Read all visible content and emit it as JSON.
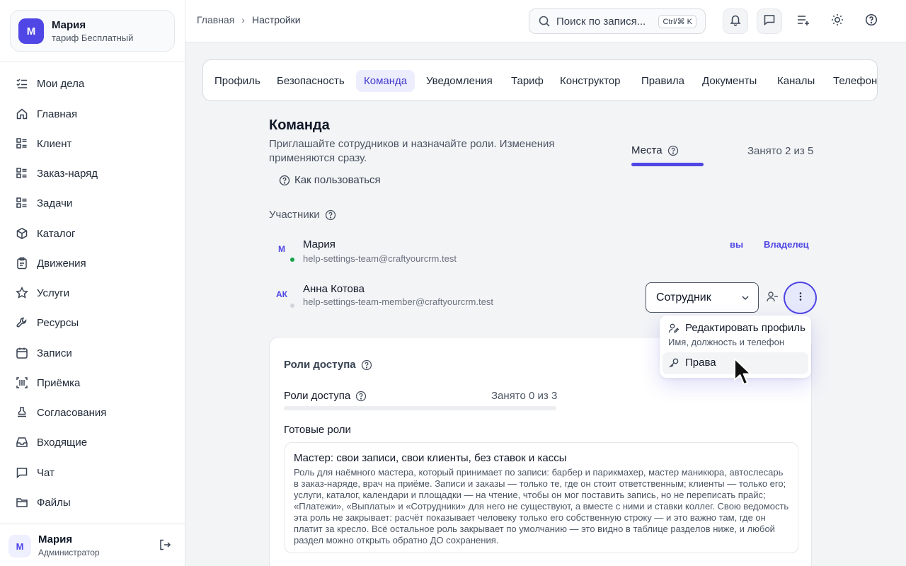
{
  "account": {
    "initial": "М",
    "name": "Мария",
    "plan": "тариф Бесплатный"
  },
  "sidebar": {
    "items": [
      {
        "label": "Мои дела",
        "icon": "task-list-icon"
      },
      {
        "label": "Главная",
        "icon": "home-icon"
      },
      {
        "label": "Клиент",
        "icon": "list-icon"
      },
      {
        "label": "Заказ-наряд",
        "icon": "list-icon"
      },
      {
        "label": "Задачи",
        "icon": "list-icon"
      },
      {
        "label": "Каталог",
        "icon": "box-icon"
      },
      {
        "label": "Движения",
        "icon": "clipboard-icon"
      },
      {
        "label": "Услуги",
        "icon": "star-icon"
      },
      {
        "label": "Ресурсы",
        "icon": "wrench-icon"
      },
      {
        "label": "Записи",
        "icon": "calendar-icon"
      },
      {
        "label": "Приёмка",
        "icon": "scan-icon"
      },
      {
        "label": "Согласования",
        "icon": "stamp-icon"
      },
      {
        "label": "Входящие",
        "icon": "inbox-icon"
      },
      {
        "label": "Чат",
        "icon": "chat-icon"
      },
      {
        "label": "Файлы",
        "icon": "folder-icon"
      }
    ]
  },
  "user": {
    "initial": "М",
    "name": "Мария",
    "role": "Администратор"
  },
  "breadcrumb": {
    "home": "Главная",
    "sep": "›",
    "current": "Настройки"
  },
  "search": {
    "placeholder": "Поиск по запися...",
    "shortcut": "Ctrl/⌘ K"
  },
  "tabs": [
    "Профиль",
    "Безопасность",
    "Команда",
    "Уведомления",
    "Тариф",
    "Конструктор",
    "Правила",
    "Документы",
    "Каналы",
    "Телефони"
  ],
  "team": {
    "title": "Команда",
    "description": "Приглашайте сотрудников и назначайте роли. Изменения применяются сразу.",
    "howto": "Как пользоваться",
    "seats_label": "Места",
    "seats_value": "Занято 2 из 5",
    "seats_fraction": 0.4,
    "members_label": "Участники",
    "members": [
      {
        "initials": "М",
        "name": "Мария",
        "email": "help-settings-team@craftyourcrm.test",
        "you": "вы",
        "role": "Владелец",
        "status_color": "#16a34a"
      },
      {
        "initials": "АК",
        "name": "Анна Котова",
        "email": "help-settings-team-member@craftyourcrm.test",
        "role": "Сотрудник",
        "status_color": "#d1d5db"
      }
    ]
  },
  "menu": {
    "edit_label": "Редактировать профиль",
    "edit_sub": "Имя, должность и телефон",
    "rights_label": "Права"
  },
  "roles": {
    "title": "Роли доступа",
    "sub_title": "Роли доступа",
    "count": "Занято 0 из 3",
    "ready_title": "Готовые роли",
    "preset_title": "Мастер: свои записи, свои клиенты, без ставок и кассы",
    "preset_desc": "Роль для наёмного мастера, который принимает по записи: барбер и парикмахер, мастер маникюра, автослесарь в заказ-наряде, врач на приёме. Записи и заказы — только те, где он стоит ответственным; клиенты — только его; услуги, каталог, календари и площадки — на чтение, чтобы он мог поставить запись, но не переписать прайс; «Платежи», «Выплаты» и «Сотрудники» для него не существуют, а вместе с ними и ставки коллег. Свою ведомость эта роль не закрывает: расчёт показывает человеку только его собственную строку — и это важно там, где он платит за кресло. Всё остальное роль закрывает по умолчанию — это видно в таблице разделов ниже, и любой раздел можно открыть обратно ДО сохранения."
  },
  "colors": {
    "accent": "#4f46e5",
    "accent_light": "#eceefe"
  }
}
